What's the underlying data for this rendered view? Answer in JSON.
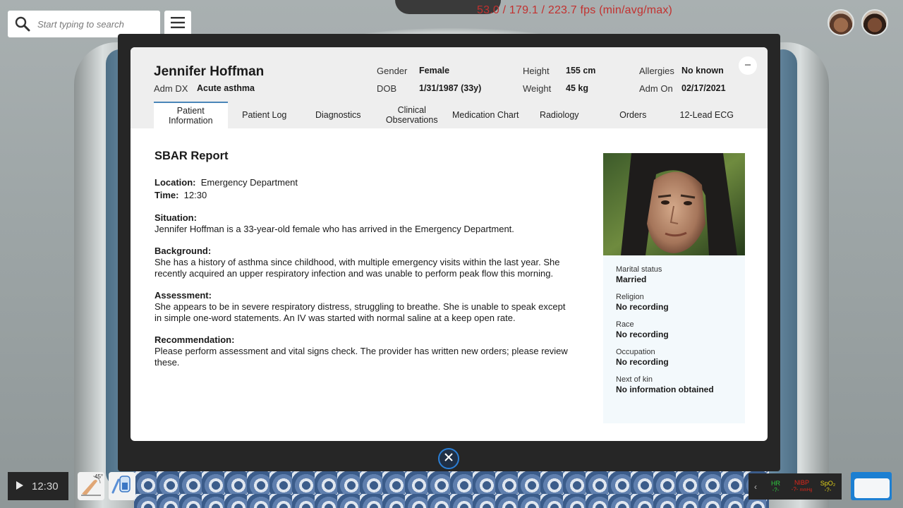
{
  "search": {
    "placeholder": "Start typing to search"
  },
  "fps_text": "53.0 / 179.1 / 223.7 fps (min/avg/max)",
  "patient": {
    "name": "Jennifer Hoffman",
    "adm_dx_label": "Adm DX",
    "adm_dx_value": "Acute asthma",
    "gender_label": "Gender",
    "gender_value": "Female",
    "dob_label": "DOB",
    "dob_value": "1/31/1987 (33y)",
    "height_label": "Height",
    "height_value": "155 cm",
    "weight_label": "Weight",
    "weight_value": "45 kg",
    "allergies_label": "Allergies",
    "allergies_value": "No known",
    "adm_on_label": "Adm On",
    "adm_on_value": "02/17/2021"
  },
  "tabs": [
    {
      "line1": "Patient",
      "line2": "Information",
      "active": true
    },
    {
      "line1": "Patient Log",
      "line2": ""
    },
    {
      "line1": "Diagnostics",
      "line2": ""
    },
    {
      "line1": "Clinical",
      "line2": "Observations"
    },
    {
      "line1": "Medication Chart",
      "line2": ""
    },
    {
      "line1": "Radiology",
      "line2": ""
    },
    {
      "line1": "Orders",
      "line2": ""
    },
    {
      "line1": "12-Lead ECG",
      "line2": ""
    }
  ],
  "sbar": {
    "title": "SBAR Report",
    "location_label": "Location:",
    "location_value": "Emergency Department",
    "time_label": "Time:",
    "time_value": "12:30",
    "situation_heading": "Situation:",
    "situation_text": "Jennifer Hoffman is a 33-year-old female who has arrived in the Emergency Department.",
    "background_heading": "Background:",
    "background_text": "She has a history of asthma since childhood, with multiple emergency visits within the last year. She recently acquired an upper respiratory infection and was unable to perform peak flow this morning.",
    "assessment_heading": "Assessment:",
    "assessment_text": "She appears to be in severe respiratory distress, struggling to breathe. She is unable to speak except in simple one-word statements. An IV was started with normal saline at a keep open rate.",
    "recommendation_heading": "Recommendation:",
    "recommendation_text": "Please perform assessment and vital signs check. The provider has written new orders; please review these."
  },
  "profile": {
    "marital_label": "Marital status",
    "marital_value": "Married",
    "religion_label": "Religion",
    "religion_value": "No recording",
    "race_label": "Race",
    "race_value": "No recording",
    "occupation_label": "Occupation",
    "occupation_value": "No recording",
    "kin_label": "Next of kin",
    "kin_value": "No information obtained"
  },
  "bottom": {
    "clock": "12:30",
    "bed_angle": "45°",
    "vitals": [
      {
        "label": "HR",
        "value": "-?-",
        "color": "#2ecc40"
      },
      {
        "label": "NIBP",
        "value": "-?-",
        "unit": "mmHg",
        "color": "#e0261b"
      },
      {
        "label": "SpO₂",
        "value": "-?-",
        "color": "#e2d21a"
      }
    ]
  },
  "icons": [
    "search-icon",
    "hamburger-menu-icon",
    "minus-icon",
    "close-icon",
    "play-icon",
    "bed-position-icon",
    "iv-bag-icon",
    "chevron-left-icon"
  ]
}
